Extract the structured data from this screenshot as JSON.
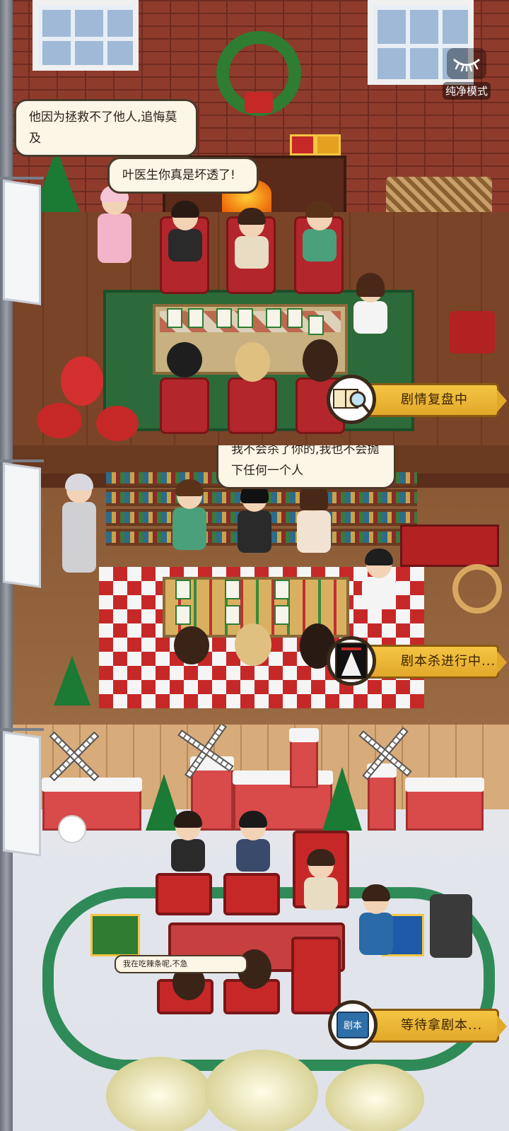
{
  "top_controls": {
    "pure_mode_label": "纯净模式",
    "pure_mode_icon": "closed-eye-icon"
  },
  "rooms": [
    {
      "theme": "christmas-living-room",
      "dialogues": [
        "他因为拯救不了他人,追悔莫及",
        "叶医生你真是坏透了!"
      ],
      "status_label": "剧情复盘中",
      "status_icon": "magnifier-book-icon"
    },
    {
      "theme": "library-room",
      "dialogues": [
        "我不会杀了你的,我也不会抛下任何一个人"
      ],
      "status_label": "剧本杀进行中...",
      "status_icon": "script-cover-icon"
    },
    {
      "theme": "toy-train-room",
      "dialogues": [
        "我在吃辣条呢,不急"
      ],
      "status_label": "等待拿剧本...",
      "status_icon": "script-book-icon",
      "script_book_text": "剧本"
    }
  ],
  "colors": {
    "banner": "#f4c542",
    "banner_border": "#8a5a12",
    "bubble_bg": "#fbf6e6",
    "brick": "#8e3b2c"
  }
}
